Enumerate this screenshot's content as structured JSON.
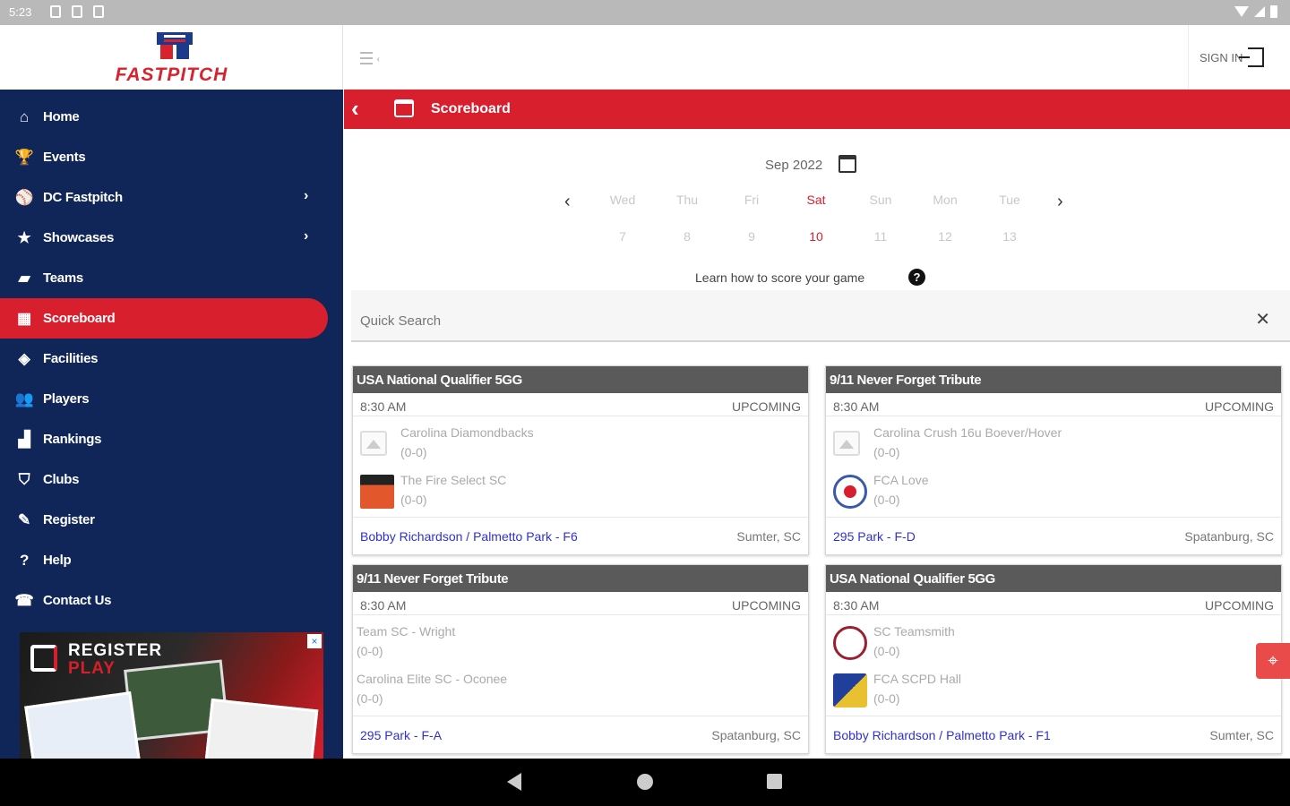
{
  "status_bar": {
    "time": "5:23"
  },
  "brand": {
    "name": "FASTPITCH"
  },
  "header": {
    "signin_label": "SIGN IN"
  },
  "sidebar": {
    "items": [
      {
        "label": "Home",
        "icon": "home-icon"
      },
      {
        "label": "Events",
        "icon": "trophy-icon"
      },
      {
        "label": "DC Fastpitch",
        "icon": "softball-icon",
        "has_submenu": true
      },
      {
        "label": "Showcases",
        "icon": "star-icon",
        "has_submenu": true
      },
      {
        "label": "Teams",
        "icon": "team-icon"
      },
      {
        "label": "Scoreboard",
        "icon": "scoreboard-icon",
        "active": true
      },
      {
        "label": "Facilities",
        "icon": "diamond-icon"
      },
      {
        "label": "Players",
        "icon": "players-icon"
      },
      {
        "label": "Rankings",
        "icon": "rankings-icon"
      },
      {
        "label": "Clubs",
        "icon": "shield-icon"
      },
      {
        "label": "Register",
        "icon": "register-icon"
      },
      {
        "label": "Help",
        "icon": "help-icon"
      },
      {
        "label": "Contact Us",
        "icon": "contact-icon"
      }
    ]
  },
  "ad": {
    "line1": "REGISTER",
    "line2": "PLAY"
  },
  "titlebar": {
    "title": "Scoreboard"
  },
  "date_picker": {
    "month": "Sep 2022",
    "days": [
      {
        "dow": "Wed",
        "date": "7"
      },
      {
        "dow": "Thu",
        "date": "8"
      },
      {
        "dow": "Fri",
        "date": "9"
      },
      {
        "dow": "Sat",
        "date": "10",
        "selected": true
      },
      {
        "dow": "Sun",
        "date": "11"
      },
      {
        "dow": "Mon",
        "date": "12"
      },
      {
        "dow": "Tue",
        "date": "13"
      }
    ]
  },
  "help_link": "Learn how to score your game",
  "search": {
    "placeholder": "Quick Search"
  },
  "games": [
    {
      "event": "USA National Qualifier 5GG",
      "time": "8:30 AM",
      "status": "UPCOMING",
      "team1": {
        "name": "Carolina Diamondbacks",
        "record": "(0-0)"
      },
      "team2": {
        "name": "The Fire Select SC",
        "record": "(0-0)"
      },
      "location": "Bobby Richardson / Palmetto Park - F6",
      "city": "Sumter, SC"
    },
    {
      "event": "9/11 Never Forget Tribute",
      "time": "8:30 AM",
      "status": "UPCOMING",
      "team1": {
        "name": "Carolina Crush 16u Boever/Hover",
        "record": "(0-0)"
      },
      "team2": {
        "name": "FCA Love",
        "record": "(0-0)"
      },
      "location": "295 Park - F-D",
      "city": "Spatanburg, SC"
    },
    {
      "event": "9/11 Never Forget Tribute",
      "time": "8:30 AM",
      "status": "UPCOMING",
      "team1": {
        "name": "Team SC - Wright",
        "record": "(0-0)"
      },
      "team2": {
        "name": "Carolina Elite SC - Oconee",
        "record": "(0-0)"
      },
      "location": "295 Park - F-A",
      "city": "Spatanburg, SC"
    },
    {
      "event": "USA National Qualifier 5GG",
      "time": "8:30 AM",
      "status": "UPCOMING",
      "team1": {
        "name": "SC Teamsmith",
        "record": "(0-0)"
      },
      "team2": {
        "name": "FCA SCPD Hall",
        "record": "(0-0)"
      },
      "location": "Bobby Richardson / Palmetto Park - F1",
      "city": "Sumter, SC"
    }
  ],
  "colors": {
    "primary_red": "#d81f2e",
    "navy": "#102558",
    "link_blue": "#3030d0"
  }
}
